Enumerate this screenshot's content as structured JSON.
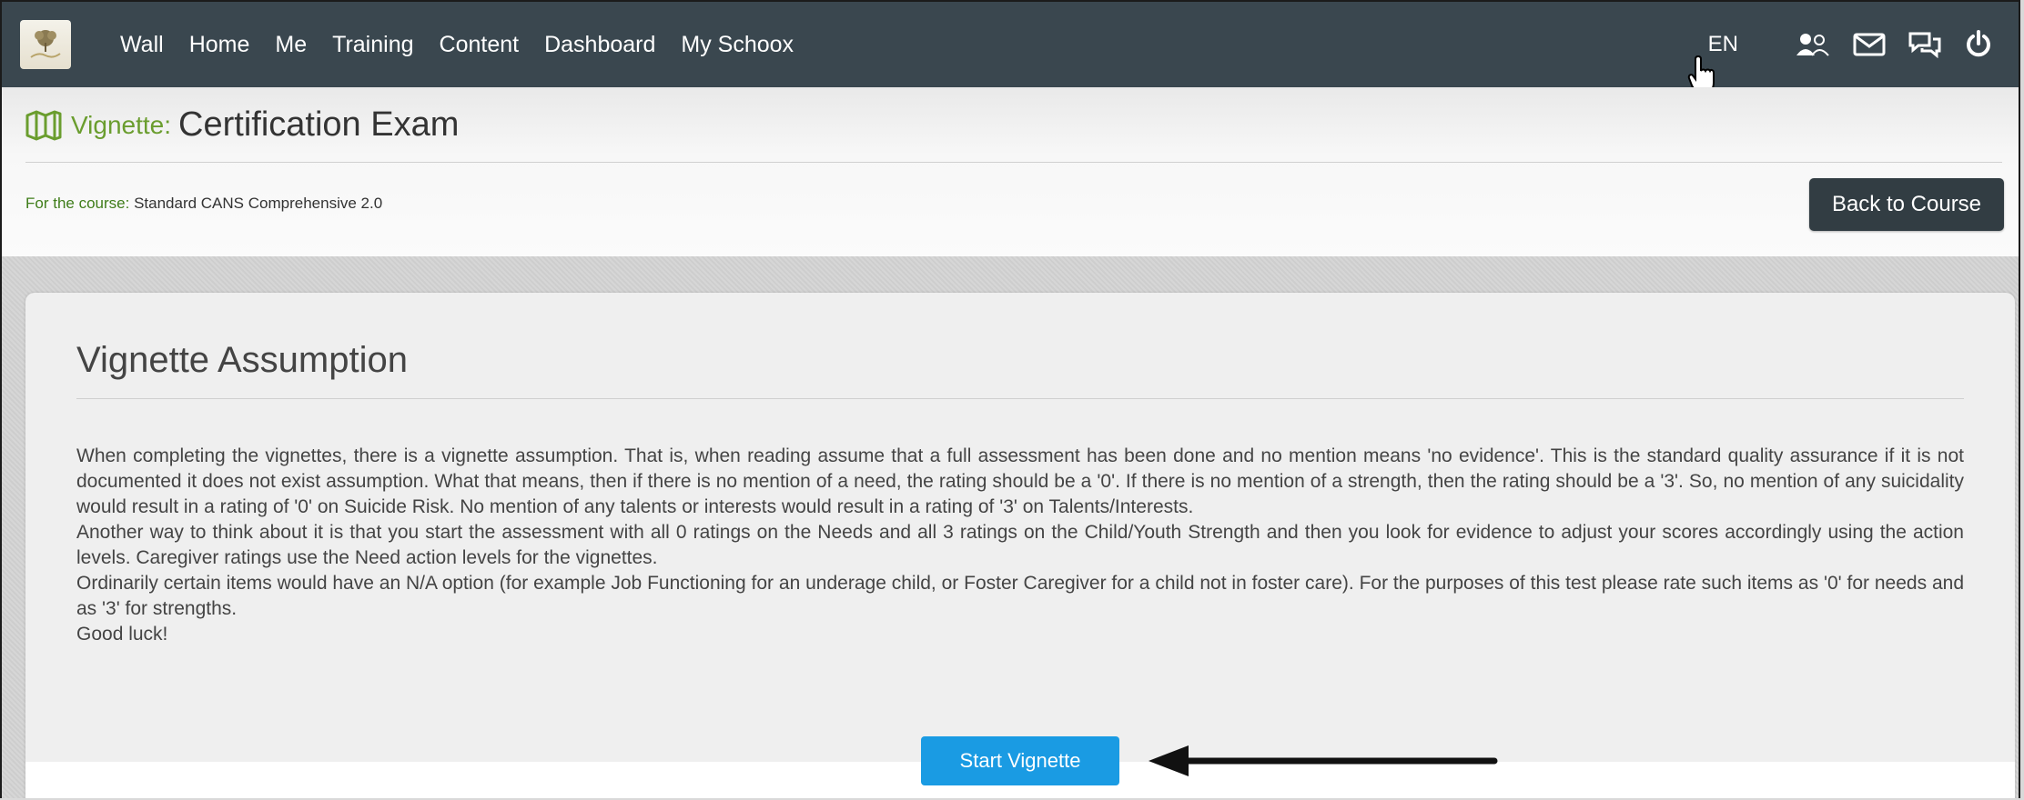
{
  "nav": {
    "items": [
      "Wall",
      "Home",
      "Me",
      "Training",
      "Content",
      "Dashboard",
      "My Schoox"
    ],
    "language": "EN",
    "icons": [
      "users-icon",
      "mail-icon",
      "chat-icon",
      "power-icon"
    ]
  },
  "header": {
    "label": "Vignette:",
    "title": "Certification Exam",
    "course_prefix": "For the course:",
    "course_name": "Standard CANS Comprehensive 2.0",
    "back_button": "Back to Course"
  },
  "card": {
    "title": "Vignette Assumption",
    "paragraphs": [
      "When completing the vignettes, there is a vignette assumption. That is, when reading assume that a full assessment has been done and no mention means 'no evidence'. This is the standard quality assurance if it is not documented it does not exist assumption. What that means, then if there is no mention of a need, the rating should be a '0'. If there is no mention of a strength, then the rating should be a '3'. So, no mention of any suicidality would result in a rating of '0' on Suicide Risk. No mention of any talents or interests would result in a rating of '3' on Talents/Interests.",
      "Another way to think about it is that you start the assessment with all 0 ratings on the Needs and all 3 ratings on the Child/Youth Strength and then you look for evidence to adjust your scores accordingly using the action levels. Caregiver ratings use the Need action levels for the vignettes.",
      "Ordinarily certain items would have an N/A option (for example Job Functioning for an underage child, or Foster Caregiver for a child not in foster care). For the purposes of this test please rate such items as '0' for needs and as '3' for strengths.",
      "Good luck!"
    ],
    "start_button": "Start Vignette"
  },
  "colors": {
    "nav_bg": "#3a474f",
    "accent_green": "#6a9d2e",
    "primary_button": "#1a9be3",
    "dark_button": "#323d43"
  }
}
